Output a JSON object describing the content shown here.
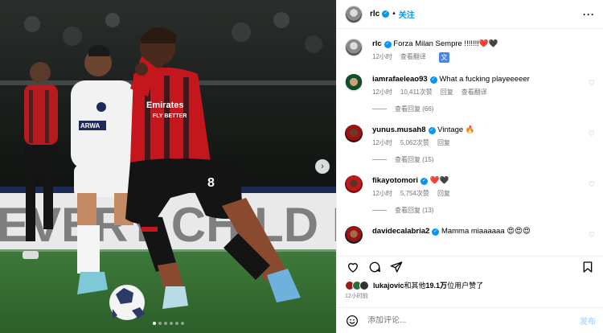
{
  "header": {
    "username": "rlc",
    "separator": "•",
    "follow_label": "关注",
    "more_label": "···",
    "avatar_icon": "profile-avatar"
  },
  "caption": {
    "username": "rlc",
    "text": "Forza Milan Sempre !!!!!!!❤️🖤",
    "time": "12小时",
    "translate_label": "查看翻译",
    "translate_icon": "translate-icon"
  },
  "comments": [
    {
      "username": "iamrafaeleao93",
      "text": "What a fucking playeeeeer",
      "time": "12小时",
      "likes": "10,411次赞",
      "reply_label": "回复",
      "translate_label": "查看翻译",
      "view_replies": "查看回复 (66)"
    },
    {
      "username": "yunus.musah8",
      "text": "Vintage 🔥",
      "time": "12小时",
      "likes": "5,062次赞",
      "reply_label": "回复",
      "view_replies": "查看回复 (15)"
    },
    {
      "username": "fikayotomori",
      "text": "❤️🖤",
      "time": "12小时",
      "likes": "5,754次赞",
      "reply_label": "回复",
      "view_replies": "查看回复 (13)"
    },
    {
      "username": "davidecalabria2",
      "text": "Mamma miaaaaaa 😍😍😍",
      "time": "",
      "likes": "",
      "reply_label": "",
      "view_replies": ""
    }
  ],
  "likes_summary": {
    "user": "lukajovic",
    "rest": "和其他",
    "count": "19.1万",
    "suffix": "位用户赞了"
  },
  "post_time": "12小时前",
  "comment_box": {
    "placeholder": "添加评论...",
    "post_label": "发布"
  },
  "media": {
    "next_label": "›",
    "dots_count": 6,
    "active_dot": 1,
    "jersey_number": "8"
  },
  "colors": {
    "accent": "#0095f6",
    "post_disabled": "#b3dbff",
    "milan_red": "#c4161c"
  }
}
